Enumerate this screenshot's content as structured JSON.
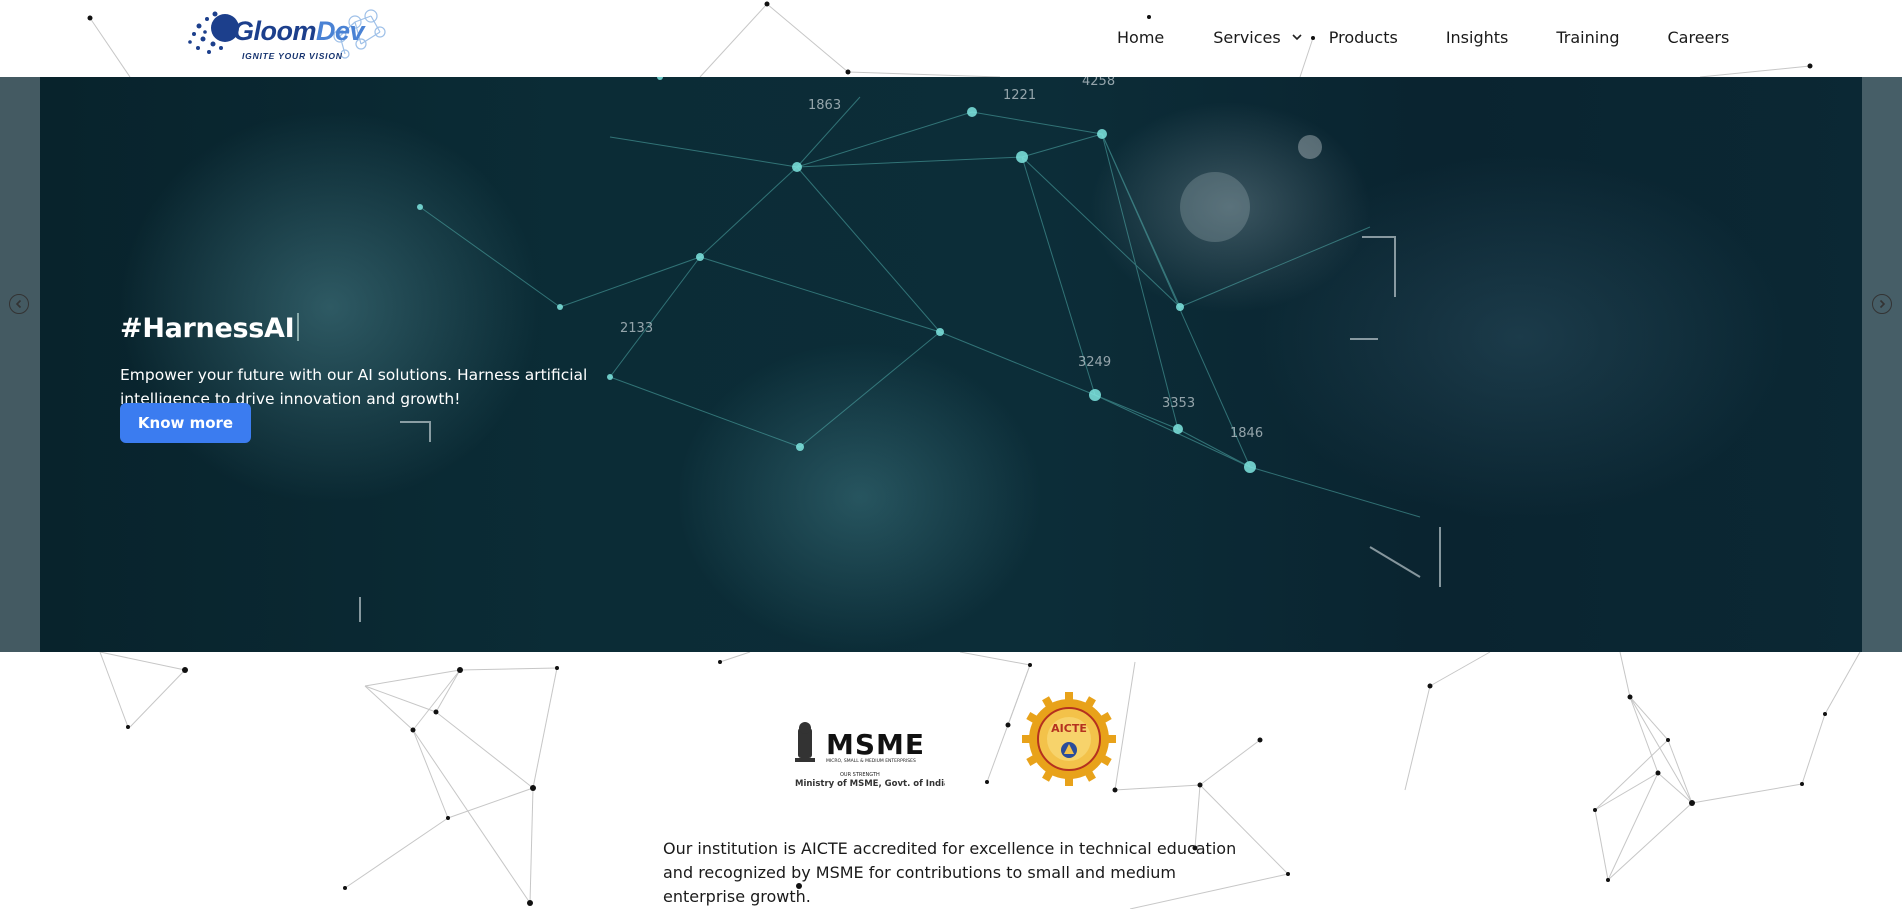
{
  "brand": {
    "name_part1": "Gloom",
    "name_part2": "Dev",
    "tagline": "IGNITE YOUR VISION"
  },
  "nav": {
    "items": [
      {
        "label": "Home"
      },
      {
        "label": "Services"
      },
      {
        "label": "Products"
      },
      {
        "label": "Insights"
      },
      {
        "label": "Training"
      },
      {
        "label": "Careers"
      }
    ],
    "services_icon": "chevron-down-icon"
  },
  "hero": {
    "title": "#HarnessAI",
    "description": "Empower your future with our AI solutions. Harness artificial intelligence to drive innovation and growth!",
    "button_label": "Know more",
    "prev_icon": "chevron-left-circle-icon",
    "next_icon": "chevron-right-circle-icon",
    "hud_labels": [
      "1863",
      "1221",
      "4258",
      "3249",
      "3353",
      "1846",
      "2133"
    ]
  },
  "accreditation": {
    "msme_logo_text": "MSME",
    "msme_small_line1": "MICRO, SMALL & MEDIUM ENTERPRISES",
    "msme_small_line2": "OUR STRENGTH",
    "msme_caption": "Ministry of MSME, Govt. of India",
    "aicte_logo_text": "AICTE",
    "statement": "Our institution is AICTE accredited for excellence in technical education and recognized by MSME for contributions to small and medium enterprise growth."
  },
  "colors": {
    "primary_button": "#3b7cf0",
    "logo_dark": "#1c3f8c",
    "logo_light": "#4a82d4",
    "hero_bg": "#0b2c36",
    "node_teal": "#3fc5c0",
    "aicte_gold": "#e8a21a"
  }
}
